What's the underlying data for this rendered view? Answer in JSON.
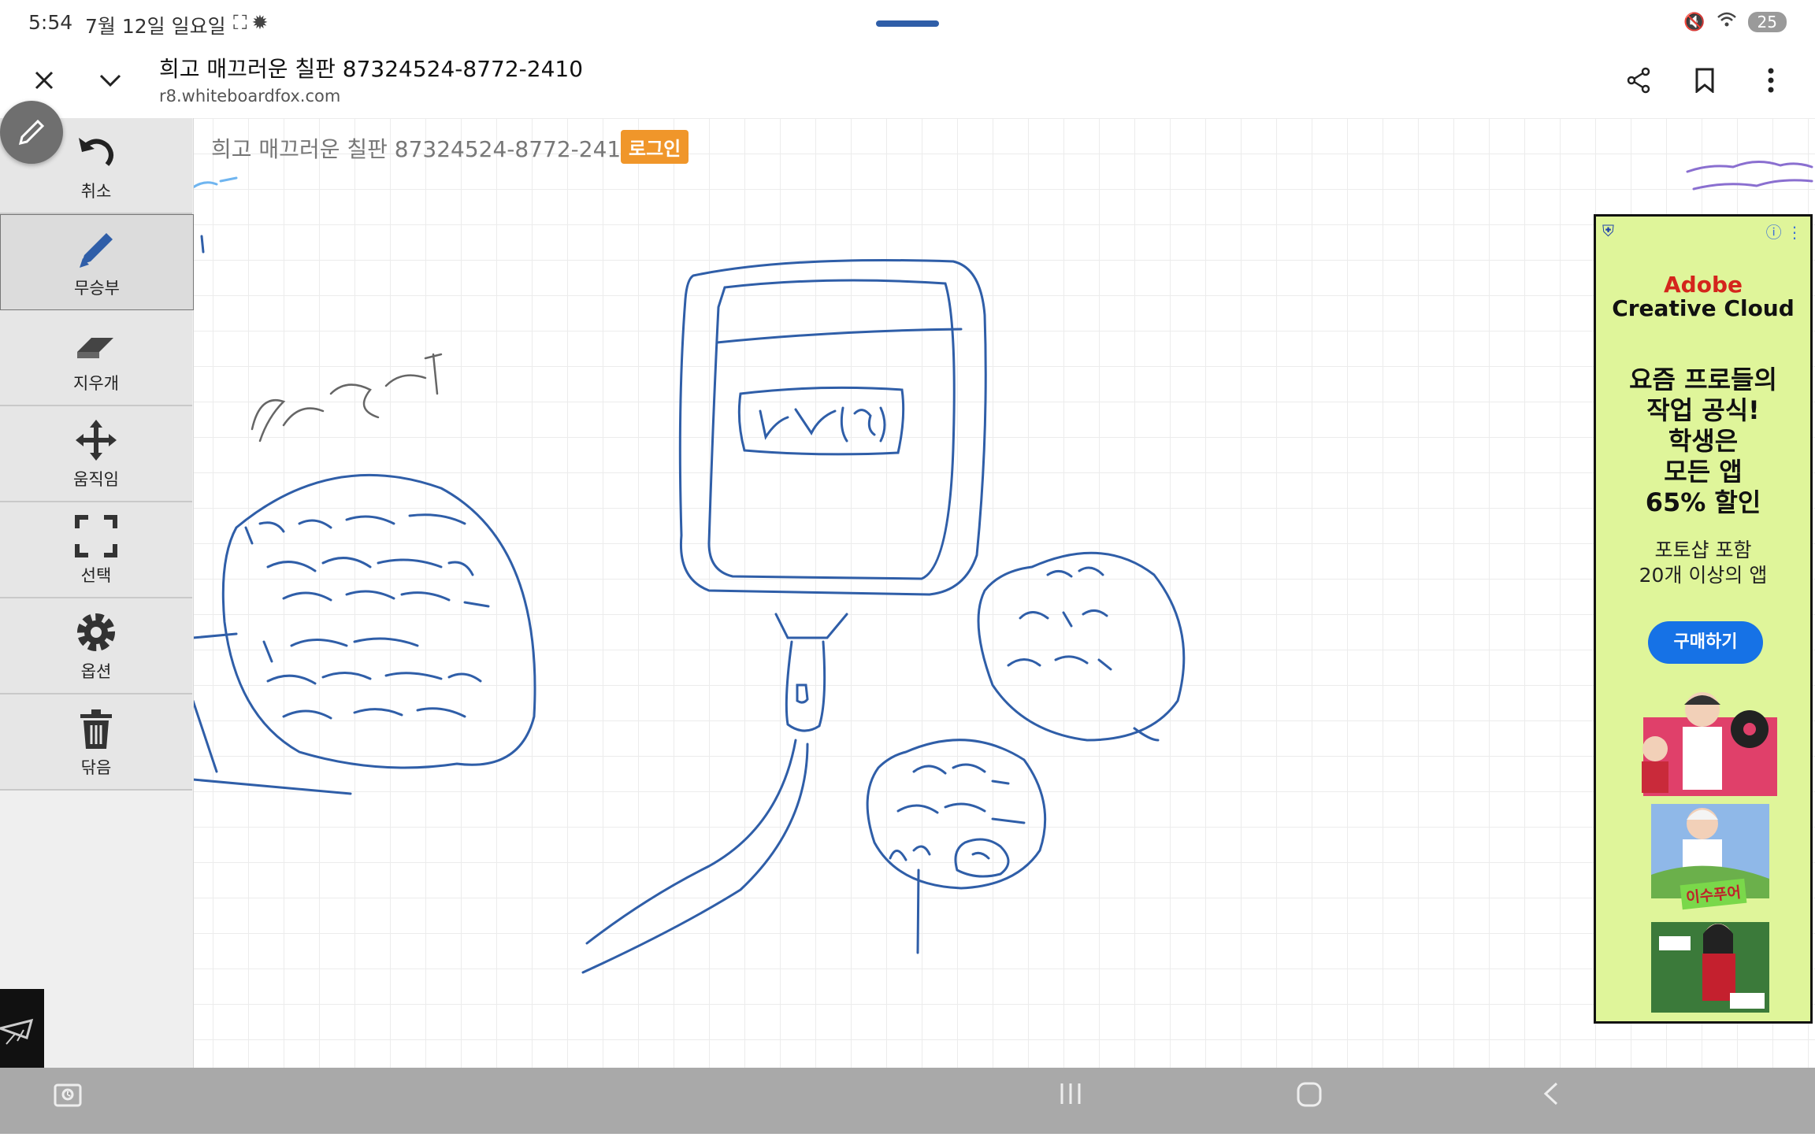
{
  "status_bar": {
    "time": "5:54",
    "date": "7월 12일 일요일",
    "battery": "25"
  },
  "browser": {
    "title": "희고 매끄러운 칠판 87324524-8772-2410",
    "url": "r8.whiteboardfox.com"
  },
  "board": {
    "title": "희고 매끄러운 칠판 87324524-8772-241",
    "login_label": "로그인"
  },
  "tools": [
    {
      "label": "취소",
      "icon": "undo-icon"
    },
    {
      "label": "무승부",
      "icon": "pencil-icon",
      "active": true
    },
    {
      "label": "지우개",
      "icon": "eraser-icon"
    },
    {
      "label": "움직임",
      "icon": "move-icon"
    },
    {
      "label": "선택",
      "icon": "select-icon"
    },
    {
      "label": "옵션",
      "icon": "gear-icon"
    },
    {
      "label": "닦음",
      "icon": "trash-icon"
    }
  ],
  "ad": {
    "brand_line1": "Adobe",
    "brand_line2": "Creative Cloud",
    "headline": [
      "요즘 프로들의",
      "작업 공식!",
      "학생은",
      "모든 앱",
      "65% 할인"
    ],
    "sub": [
      "포토샵 포함",
      "20개 이상의 앱"
    ],
    "button": "구매하기",
    "tag": "이수푸어",
    "info": "ⓘ ⋮"
  },
  "colors": {
    "ink": "#2f5ea8",
    "login": "#f0962a",
    "ad_bg": "#dff59a",
    "ad_button": "#1672e6",
    "brand": "#d4251c"
  }
}
